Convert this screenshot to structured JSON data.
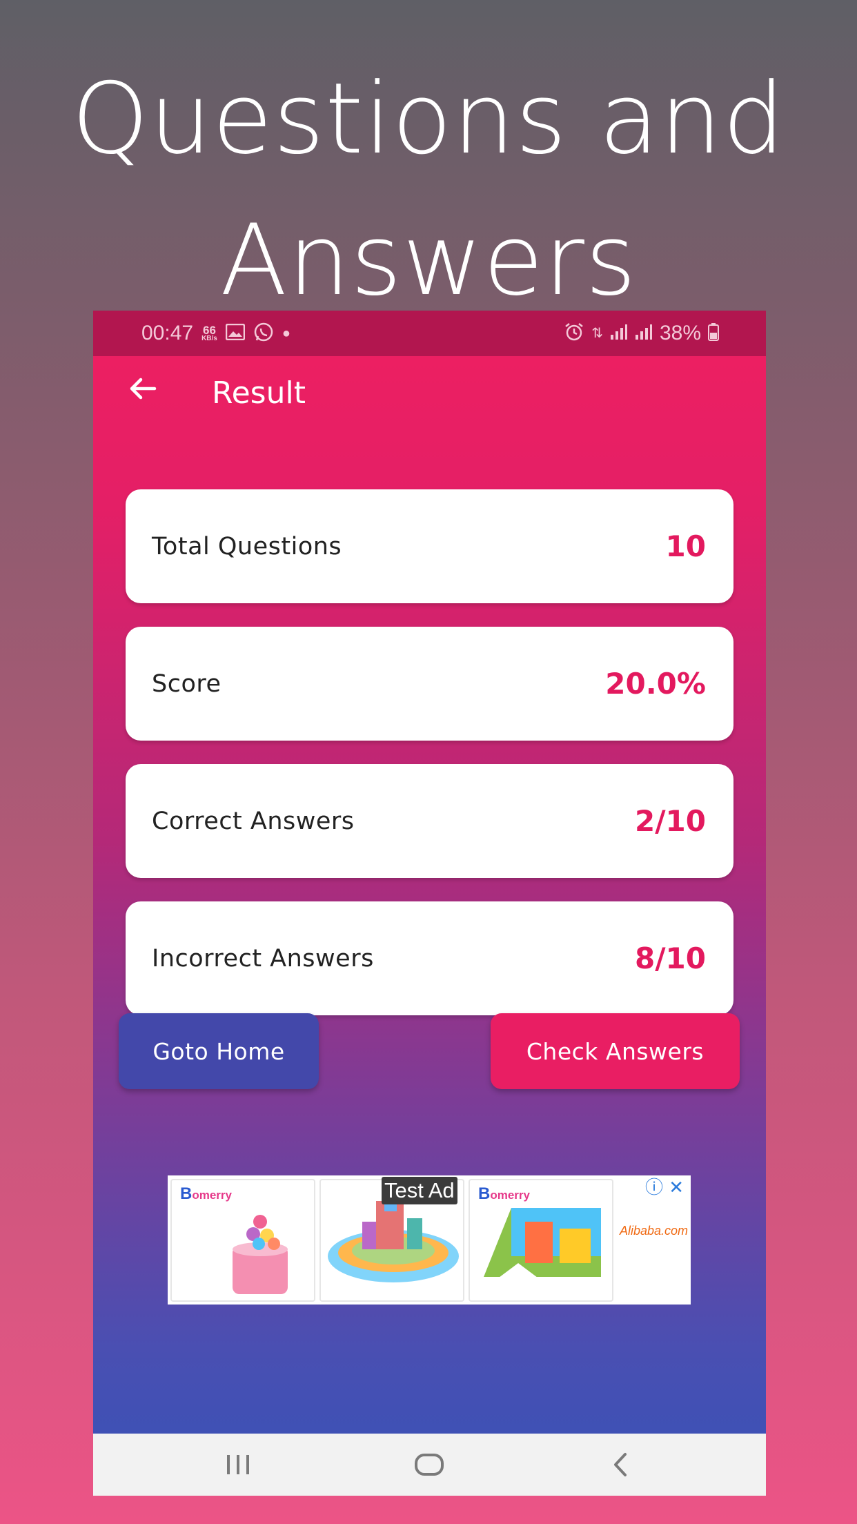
{
  "promo": {
    "line1": "Questions and",
    "line2": "Answers"
  },
  "status_bar": {
    "time": "00:47",
    "speed_value": "66",
    "speed_unit": "KB/s",
    "battery": "38%"
  },
  "app_bar": {
    "title": "Result"
  },
  "results": [
    {
      "label": "Total Questions",
      "value": "10"
    },
    {
      "label": "Score",
      "value": "20.0%"
    },
    {
      "label": "Correct Answers",
      "value": "2/10"
    },
    {
      "label": "Incorrect Answers",
      "value": "8/10"
    }
  ],
  "buttons": {
    "home": "Goto Home",
    "check": "Check Answers"
  },
  "ad": {
    "tag": "Test Ad"
  },
  "colors": {
    "accent": "#e91e63",
    "status_bar": "#b2164f",
    "home_button": "#4348aa",
    "value_text": "#e3195e"
  }
}
